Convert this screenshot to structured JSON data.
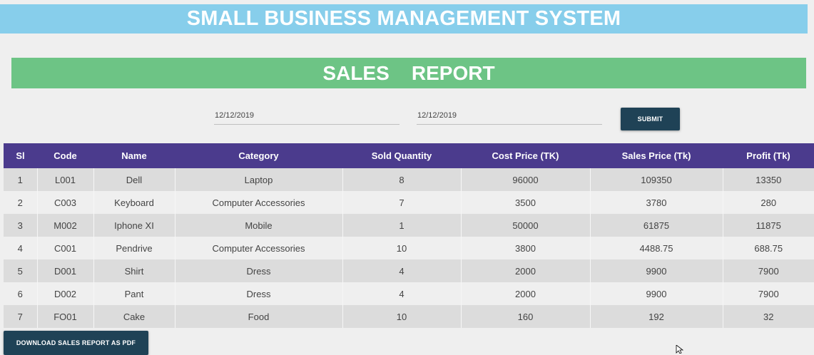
{
  "app": {
    "title": "SMALL BUSINESS MANAGEMENT SYSTEM",
    "report_title": "SALES    REPORT"
  },
  "filters": {
    "date_from": "12/12/2019",
    "date_to": "12/12/2019",
    "submit_label": "SUBMIT"
  },
  "table": {
    "headers": [
      "Sl",
      "Code",
      "Name",
      "Category",
      "Sold Quantity",
      "Cost Price (TK)",
      "Sales Price (Tk)",
      "Profit (Tk)"
    ],
    "rows": [
      [
        "1",
        "L001",
        "Dell",
        "Laptop",
        "8",
        "96000",
        "109350",
        "13350"
      ],
      [
        "2",
        "C003",
        "Keyboard",
        "Computer Accessories",
        "7",
        "3500",
        "3780",
        "280"
      ],
      [
        "3",
        "M002",
        "Iphone XI",
        "Mobile",
        "1",
        "50000",
        "61875",
        "11875"
      ],
      [
        "4",
        "C001",
        "Pendrive",
        "Computer Accessories",
        "10",
        "3800",
        "4488.75",
        "688.75"
      ],
      [
        "5",
        "D001",
        "Shirt",
        "Dress",
        "4",
        "2000",
        "9900",
        "7900"
      ],
      [
        "6",
        "D002",
        "Pant",
        "Dress",
        "4",
        "2000",
        "9900",
        "7900"
      ],
      [
        "7",
        "FO01",
        "Cake",
        "Food",
        "10",
        "160",
        "192",
        "32"
      ]
    ]
  },
  "actions": {
    "download_label": "DOWNLOAD SALES REPORT AS PDF"
  },
  "colors": {
    "banner": "#87ceeb",
    "report_bar": "#6dc485",
    "table_header": "#4b3b8d",
    "button": "#1f4256"
  }
}
